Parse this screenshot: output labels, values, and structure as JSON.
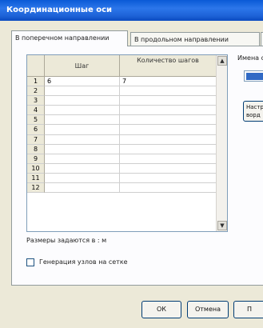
{
  "window": {
    "title": "Координационные оси"
  },
  "tabs": [
    {
      "label": "В поперечном направлении"
    },
    {
      "label": "В продольном направлении"
    },
    {
      "label": "П"
    }
  ],
  "grid": {
    "columns": [
      "",
      "Шаг",
      "Количество шагов"
    ],
    "rows": [
      {
        "num": "1",
        "step": "6",
        "count": "7"
      },
      {
        "num": "2",
        "step": "",
        "count": ""
      },
      {
        "num": "3",
        "step": "",
        "count": ""
      },
      {
        "num": "4",
        "step": "",
        "count": ""
      },
      {
        "num": "5",
        "step": "",
        "count": ""
      },
      {
        "num": "6",
        "step": "",
        "count": ""
      },
      {
        "num": "7",
        "step": "",
        "count": ""
      },
      {
        "num": "8",
        "step": "",
        "count": ""
      },
      {
        "num": "9",
        "step": "",
        "count": ""
      },
      {
        "num": "10",
        "step": "",
        "count": ""
      },
      {
        "num": "11",
        "step": "",
        "count": ""
      },
      {
        "num": "12",
        "step": "",
        "count": ""
      }
    ],
    "scroll_up_glyph": "▲",
    "scroll_down_glyph": "▼"
  },
  "units_label": "Размеры задаются в : м",
  "checkbox": {
    "label": "Генерация узлов на сетке",
    "checked": false
  },
  "right_panel": {
    "name_label": "Имена о",
    "name_value": "",
    "button_label": "Настр ворд"
  },
  "buttons": {
    "ok": "ОК",
    "cancel": "Отмена",
    "partial": "П"
  },
  "colors": {
    "titlebar": "#0a5ad6",
    "dialog_bg": "#ece9d8",
    "selection": "#316ac5"
  }
}
